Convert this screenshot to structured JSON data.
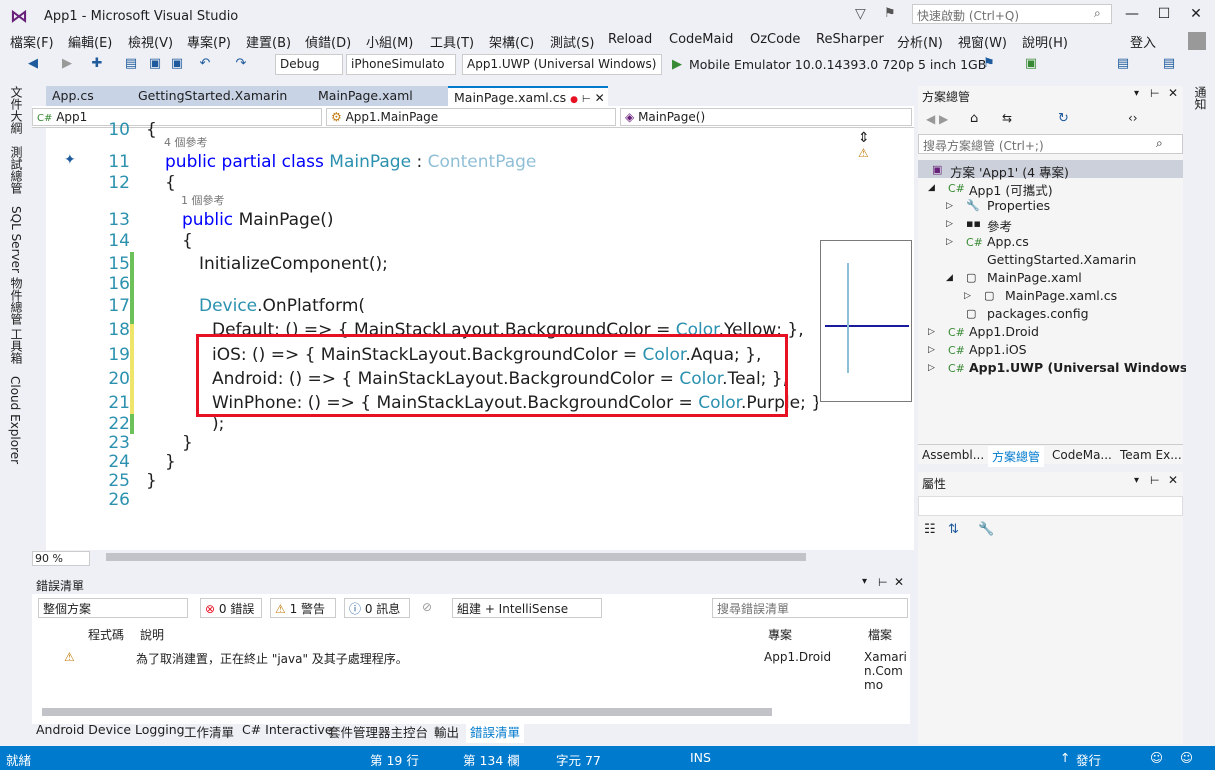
{
  "window": {
    "title": "App1 - Microsoft Visual Studio",
    "quick_launch_placeholder": "快速啟動 (Ctrl+Q)",
    "sign_in": "登入"
  },
  "menu": [
    "檔案(F)",
    "編輯(E)",
    "檢視(V)",
    "專案(P)",
    "建置(B)",
    "偵錯(D)",
    "小組(M)",
    "工具(T)",
    "架構(C)",
    "測試(S)",
    "Reload",
    "CodeMaid",
    "OzCode",
    "ReSharper",
    "分析(N)",
    "視窗(W)",
    "說明(H)"
  ],
  "toolbar": {
    "config": "Debug",
    "platform": "iPhoneSimulato",
    "startup_project": "App1.UWP (Universal Windows)",
    "run_target": "Mobile Emulator 10.0.14393.0 720p 5 inch 1GB"
  },
  "left_tabs": [
    "文件大綱",
    "測試總管",
    "SQL Server 物件總管",
    "工具箱",
    "Cloud Explorer"
  ],
  "doc_tabs": [
    "App.cs",
    "GettingStarted.Xamarin",
    "MainPage.xaml",
    "MainPage.xaml.cs"
  ],
  "navbar": {
    "project": "App1",
    "class": "App1.MainPage",
    "member": "MainPage()"
  },
  "editor": {
    "references_4": "4 個參考",
    "references_1": "1 個參考",
    "lines": [
      {
        "n": "10",
        "text": "{"
      },
      {
        "n": "11",
        "kw": "public partial class ",
        "name": "MainPage",
        "sep": " : ",
        "base": "ContentPage"
      },
      {
        "n": "12",
        "text": "{"
      },
      {
        "n": "13",
        "kw": "public ",
        "text": "MainPage()"
      },
      {
        "n": "14",
        "text": "{"
      },
      {
        "n": "15",
        "text": "InitializeComponent();"
      },
      {
        "n": "16",
        "text": ""
      },
      {
        "n": "17",
        "ty": "Device",
        "text": ".OnPlatform("
      },
      {
        "n": "18",
        "pre": "Default: () => { MainStackLayout.BackgroundColor = ",
        "ty": "Color",
        "post": ".Yellow; },"
      },
      {
        "n": "19",
        "pre": "iOS: () => { MainStackLayout.BackgroundColor = ",
        "ty": "Color",
        "post": ".Aqua; },"
      },
      {
        "n": "20",
        "pre": "Android: () => { MainStackLayout.BackgroundColor = ",
        "ty": "Color",
        "post": ".Teal; },"
      },
      {
        "n": "21",
        "pre": "WinPhone: () => { MainStackLayout.BackgroundColor = ",
        "ty": "Color",
        "post": ".Purple; }"
      },
      {
        "n": "22",
        "text": ");"
      },
      {
        "n": "23",
        "text": "}"
      },
      {
        "n": "24",
        "text": "}"
      },
      {
        "n": "25",
        "text": "}"
      },
      {
        "n": "26",
        "text": ""
      }
    ],
    "zoom": "90 %"
  },
  "solution_explorer": {
    "title": "方案總管",
    "search_placeholder": "搜尋方案總管 (Ctrl+;)",
    "items": [
      "方案 'App1' (4 專案)",
      "App1 (可攜式)",
      "Properties",
      "參考",
      "App.cs",
      "GettingStarted.Xamarin",
      "MainPage.xaml",
      "MainPage.xaml.cs",
      "packages.config",
      "App1.Droid",
      "App1.iOS",
      "App1.UWP (Universal Windows)"
    ],
    "tabs": [
      "Assembl...",
      "方案總管",
      "CodeMa...",
      "Team Ex..."
    ]
  },
  "right_tabs": [
    "通知"
  ],
  "properties": {
    "title": "屬性"
  },
  "error_list": {
    "title": "錯誤清單",
    "scope": "整個方案",
    "errors": "0 錯誤",
    "warnings": "1 警告",
    "messages": "0 訊息",
    "filter": "組建 + IntelliSense",
    "search_placeholder": "搜尋錯誤清單",
    "columns": [
      "程式碼",
      "說明",
      "專案",
      "檔案"
    ],
    "rows": [
      {
        "code": "",
        "desc": "為了取消建置，正在終止 \"java\" 及其子處理程序。",
        "project": "App1.Droid",
        "file": "Xamarin.Commo"
      }
    ]
  },
  "bottom_tabs": [
    "Android Device Logging",
    "工作清單",
    "C# Interactive",
    "套件管理器主控台",
    "輸出",
    "錯誤清單"
  ],
  "status": {
    "ready": "就緒",
    "line": "第 19 行",
    "col": "第 134 欄",
    "char": "字元 77",
    "ins": "INS",
    "publish": "發行"
  },
  "colors": {
    "accent": "#007acc",
    "highlight_box": "#e81123",
    "keyword": "#0000ff",
    "type": "#2b91af"
  }
}
